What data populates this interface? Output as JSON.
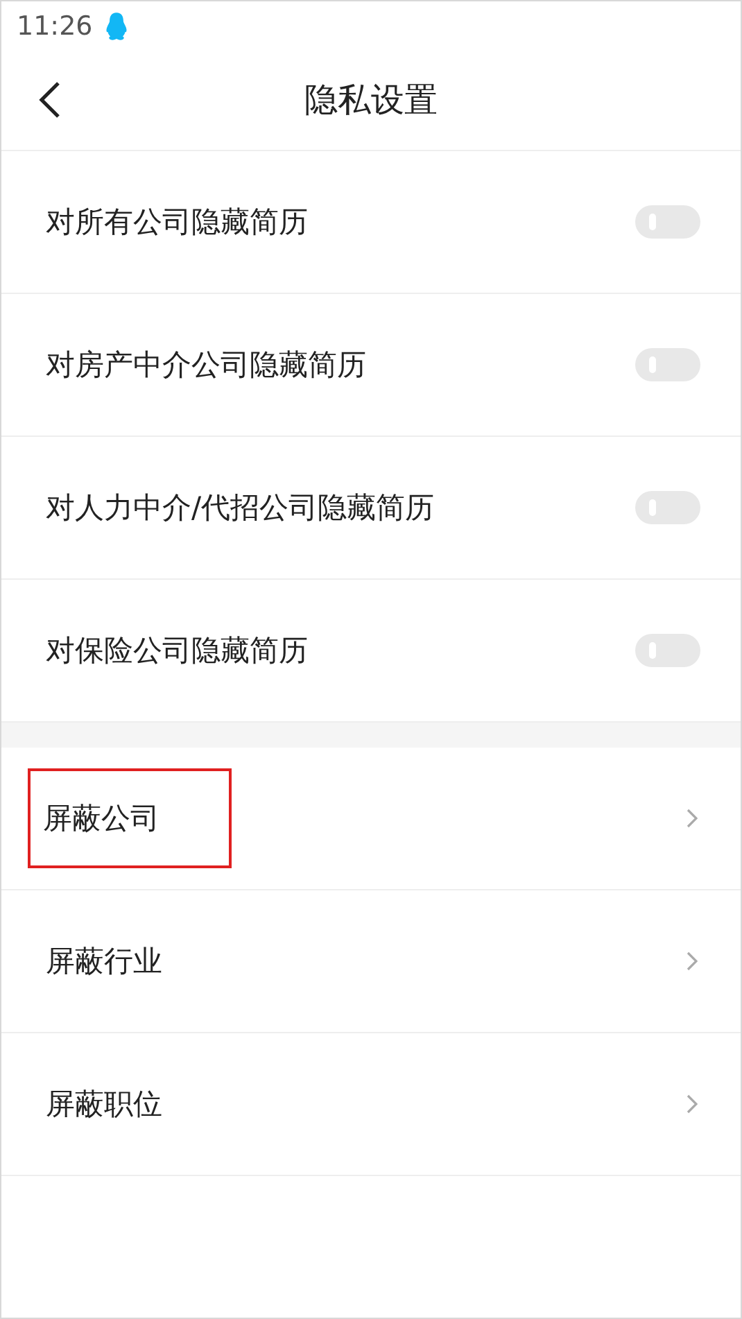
{
  "status_bar": {
    "time": "11:26"
  },
  "header": {
    "title": "隐私设置"
  },
  "toggles": [
    {
      "label": "对所有公司隐藏简历",
      "on": false
    },
    {
      "label": "对房产中介公司隐藏简历",
      "on": false
    },
    {
      "label": "对人力中介/代招公司隐藏简历",
      "on": false
    },
    {
      "label": "对保险公司隐藏简历",
      "on": false
    }
  ],
  "links": [
    {
      "label": "屏蔽公司",
      "highlighted": true
    },
    {
      "label": "屏蔽行业",
      "highlighted": false
    },
    {
      "label": "屏蔽职位",
      "highlighted": false
    }
  ]
}
